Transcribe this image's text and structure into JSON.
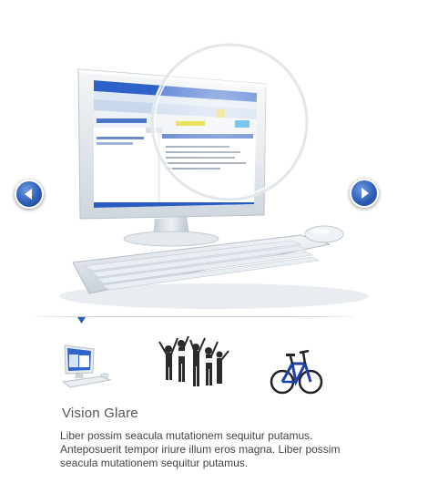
{
  "slider": {
    "prev_icon": "chevron-left-icon",
    "next_icon": "chevron-right-icon",
    "accent_color": "#2d5fb8",
    "active_index": 0
  },
  "thumbnails": [
    {
      "name": "computer-thumbnail",
      "icon": "monitor-icon"
    },
    {
      "name": "people-thumbnail",
      "icon": "group-icon"
    },
    {
      "name": "bicycle-thumbnail",
      "icon": "bicycle-icon"
    }
  ],
  "caption": {
    "title": "Vision Glare",
    "text": "Liber possim seacula mutationem sequitur putamus. Anteposuerit tempor iriure illum eros magna. Liber possim seacula mutationem sequitur putamus."
  }
}
